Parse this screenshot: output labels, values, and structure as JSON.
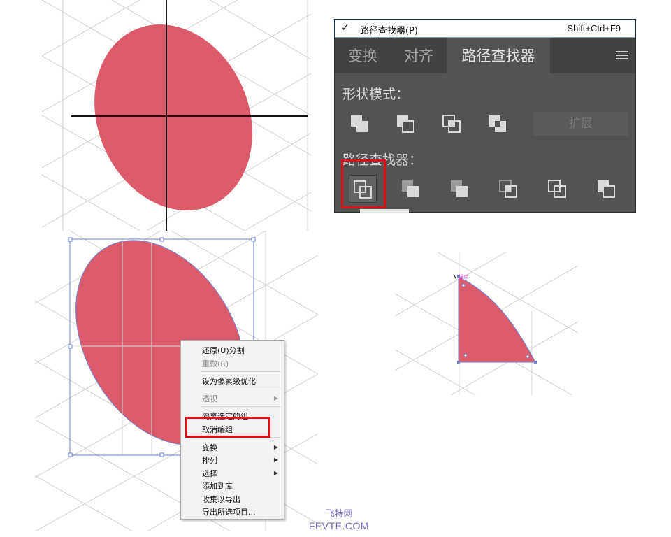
{
  "pathfinder_panel": {
    "menu_item": {
      "check": "✓",
      "label": "路径查找器(P)",
      "shortcut": "Shift+Ctrl+F9"
    },
    "tabs": [
      {
        "label": "变换",
        "active": false
      },
      {
        "label": "对齐",
        "active": false
      },
      {
        "label": "路径查找器",
        "active": true
      }
    ],
    "panel_menu_icon": "hamburger-icon",
    "shape_modes": {
      "heading": "形状模式：",
      "buttons": [
        "unite-icon",
        "minus-front-icon",
        "intersect-icon",
        "exclude-icon"
      ],
      "expand_label": "扩展"
    },
    "pathfinders": {
      "heading": "路径查找器：",
      "buttons": [
        "divide-icon",
        "trim-icon",
        "merge-icon",
        "crop-icon",
        "outline-icon",
        "minus-back-icon"
      ],
      "highlighted": "divide-icon"
    }
  },
  "context_menu": {
    "items": [
      {
        "label": "还原(U)分割",
        "disabled": false,
        "submenu": false
      },
      {
        "label": "重做(R)",
        "disabled": true,
        "submenu": false
      },
      {
        "label": "设为像素级优化",
        "disabled": false,
        "submenu": false
      },
      {
        "label": "透视",
        "disabled": true,
        "submenu": true
      },
      {
        "label": "隔离选定的组",
        "disabled": false,
        "submenu": false
      },
      {
        "label": "取消编组",
        "disabled": false,
        "submenu": false,
        "highlighted": true
      },
      {
        "label": "变换",
        "disabled": false,
        "submenu": true
      },
      {
        "label": "排列",
        "disabled": false,
        "submenu": true
      },
      {
        "label": "选择",
        "disabled": false,
        "submenu": true
      },
      {
        "label": "添加到库",
        "disabled": false,
        "submenu": false
      },
      {
        "label": "收集以导出",
        "disabled": false,
        "submenu": false
      },
      {
        "label": "导出所选项目...",
        "disabled": false,
        "submenu": false
      }
    ]
  },
  "canvas": {
    "shape_color": "#dc5b6b",
    "selection_color": "#6e7fd6",
    "anchor_label": "锚点",
    "grid_color": "#cccccc"
  },
  "watermark": {
    "cn": "飞特网",
    "en": "FEVTE.COM"
  },
  "colors": {
    "highlight_red": "#e10d16",
    "panel_bg": "#535353",
    "panel_tab_bg": "#434343"
  }
}
